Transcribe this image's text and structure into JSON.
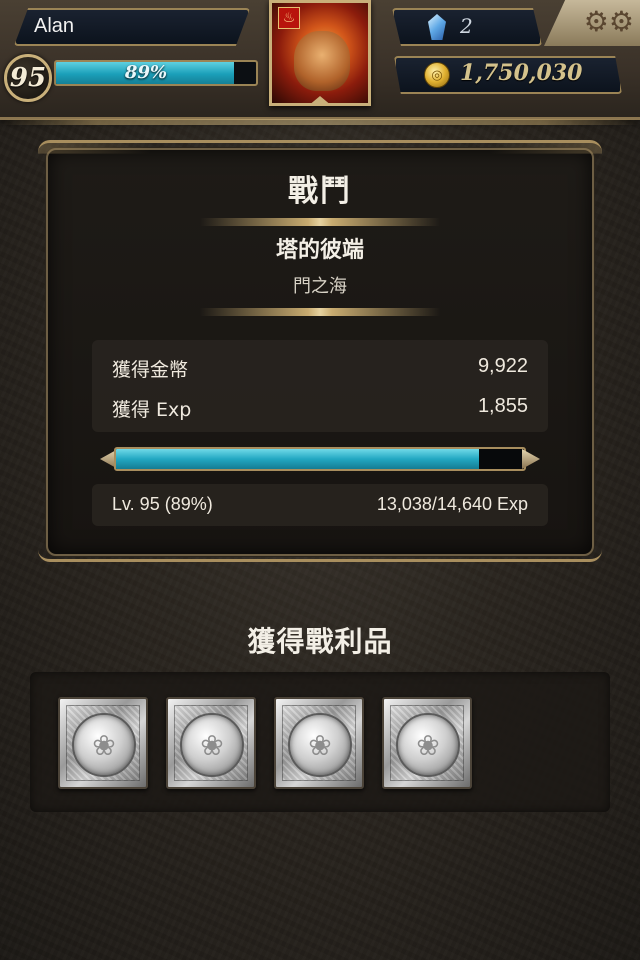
{
  "hud": {
    "player_name": "Alan",
    "level": "95",
    "exp_percent_label": "89%",
    "exp_percent": 0.89,
    "gems": "2",
    "coins": "1,750,030"
  },
  "result": {
    "title": "戰鬥",
    "stage_name": "塔的彼端",
    "stage_sub": "門之海",
    "coins_label": "獲得金幣",
    "coins_value": "9,922",
    "exp_label": "獲得 Exp",
    "exp_value": "1,855",
    "level_label": "Lv. 95 (89%)",
    "exp_progress_label": "13,038/14,640 Exp",
    "exp_progress": 0.89
  },
  "loot": {
    "title": "獲得戰利品",
    "items": [
      {
        "icon": "silver-coin-icon"
      },
      {
        "icon": "silver-coin-icon"
      },
      {
        "icon": "silver-coin-icon"
      },
      {
        "icon": "silver-coin-icon"
      }
    ]
  },
  "colors": {
    "accent_exp": "#22a8c2",
    "frame_gold": "#a88e5e",
    "background": "#2a251f"
  }
}
